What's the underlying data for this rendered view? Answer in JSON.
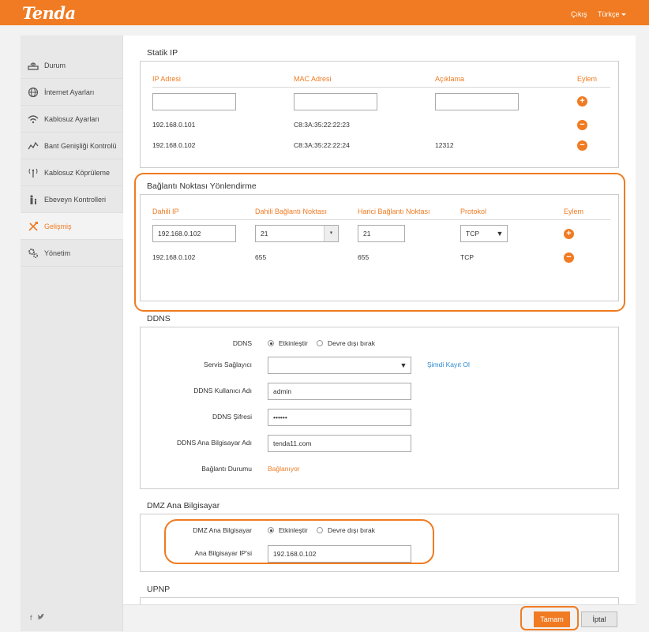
{
  "header": {
    "logo": "Tenda",
    "logout": "Çıkış",
    "language": "Türkçe"
  },
  "sidebar": {
    "items": [
      {
        "label": "Durum",
        "icon": "router-icon"
      },
      {
        "label": "İnternet Ayarları",
        "icon": "globe-icon"
      },
      {
        "label": "Kablosuz Ayarları",
        "icon": "wifi-icon"
      },
      {
        "label": "Bant Genişliği Kontrolü",
        "icon": "bandwidth-icon"
      },
      {
        "label": "Kablosuz Köprüleme",
        "icon": "antenna-icon"
      },
      {
        "label": "Ebeveyn Kontrolleri",
        "icon": "parent-icon"
      },
      {
        "label": "Gelişmiş",
        "icon": "tools-icon",
        "active": true
      },
      {
        "label": "Yönetim",
        "icon": "gears-icon"
      }
    ],
    "social": "f  🐦"
  },
  "static_ip": {
    "title": "Statik IP",
    "headers": [
      "IP Adresi",
      "MAC Adresi",
      "Açıklama",
      "Eylem"
    ],
    "rows": [
      {
        "ip": "192.168.0.101",
        "mac": "C8:3A:35:22:22:23",
        "desc": ""
      },
      {
        "ip": "192.168.0.102",
        "mac": "C8:3A:35:22:22:24",
        "desc": "12312"
      }
    ]
  },
  "port_forward": {
    "title": "Bağlantı Noktası Yönlendirme",
    "headers": [
      "Dahili IP",
      "Dahili Bağlantı Noktası",
      "Harici Bağlantı Noktası",
      "Protokol",
      "Eylem"
    ],
    "input": {
      "ip": "192.168.0.102",
      "internal_port": "21",
      "external_port": "21",
      "protocol": "TCP"
    },
    "rows": [
      {
        "ip": "192.168.0.102",
        "internal_port": "655",
        "external_port": "655",
        "protocol": "TCP"
      }
    ]
  },
  "ddns": {
    "title": "DDNS",
    "ddns_label": "DDNS",
    "enable": "Etkinleştir",
    "disable": "Devre dışı bırak",
    "provider_label": "Servis Sağlayıcı",
    "provider_value": "",
    "register_link": "Şimdi Kayıt Ol",
    "user_label": "DDNS Kullanıcı Adı",
    "user_value": "admin",
    "password_label": "DDNS Şifresi",
    "password_value": "••••••",
    "host_label": "DDNS Ana Bilgisayar Adı",
    "host_value": "tenda11.com",
    "status_label": "Bağlantı Durumu",
    "status_value": "Bağlanıyor"
  },
  "dmz": {
    "title": "DMZ Ana Bilgisayar",
    "host_label": "DMZ Ana Bilgisayar",
    "enable": "Etkinleştir",
    "disable": "Devre dışı bırak",
    "ip_label": "Ana Bilgisayar IP'si",
    "ip_value": "192.168.0.102"
  },
  "upnp": {
    "title": "UPNP"
  },
  "footer": {
    "ok": "Tamam",
    "cancel": "İptal"
  },
  "colors": {
    "accent": "#f07b22",
    "link": "#2a8ad4"
  }
}
